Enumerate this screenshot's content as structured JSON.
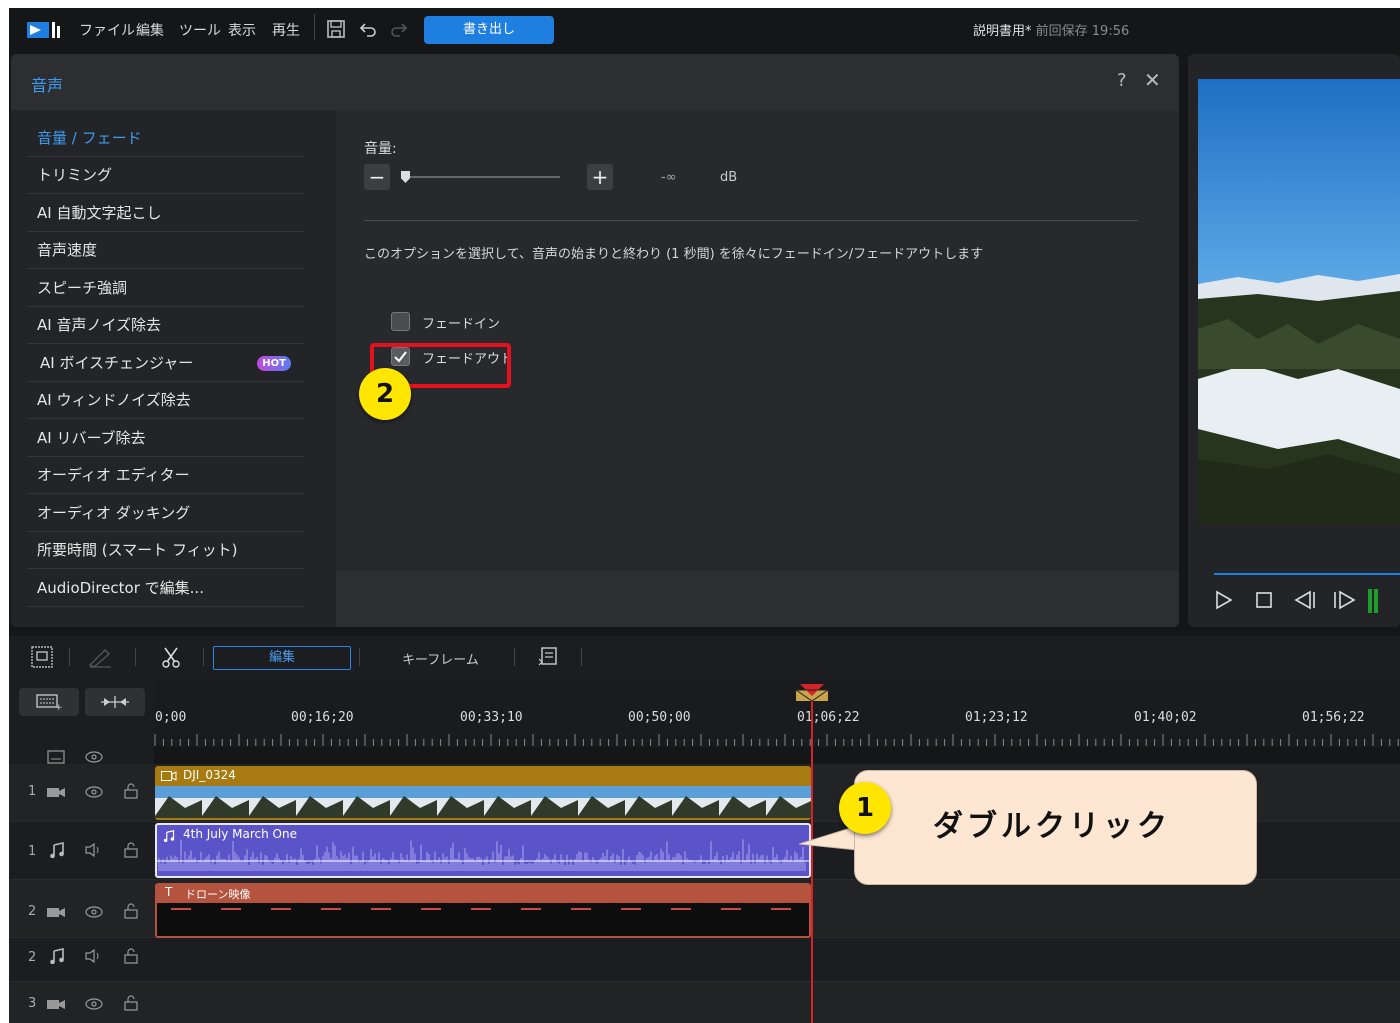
{
  "menubar": {
    "items": [
      "ファイル",
      "編集",
      "ツール",
      "表示",
      "再生"
    ],
    "export_label": "書き出し",
    "project_name": "説明書用*",
    "last_saved": "前回保存 19:56"
  },
  "dialog": {
    "title": "音声",
    "help": "?",
    "close": "✕",
    "sidebar": [
      {
        "label": "音量 / フェード",
        "active": true
      },
      {
        "label": "トリミング"
      },
      {
        "label": "AI 自動文字起こし"
      },
      {
        "label": "音声速度"
      },
      {
        "label": "スピーチ強調"
      },
      {
        "label": "AI 音声ノイズ除去"
      },
      {
        "label": "AI ボイスチェンジャー",
        "badge": "HOT"
      },
      {
        "label": "AI ウィンドノイズ除去"
      },
      {
        "label": "AI リバーブ除去"
      },
      {
        "label": "オーディオ エディター"
      },
      {
        "label": "オーディオ ダッキング"
      },
      {
        "label": "所要時間 (スマート フィット)"
      },
      {
        "label": "AudioDirector で編集..."
      }
    ],
    "volume": {
      "label": "音量:",
      "minus": "−",
      "plus": "+",
      "value": "-∞",
      "unit": "dB"
    },
    "description": "このオプションを選択して、音声の始まりと終わり (1 秒間) を徐々にフェードイン/フェードアウトします",
    "fade_in": {
      "label": "フェードイン",
      "checked": false
    },
    "fade_out": {
      "label": "フェードアウト",
      "checked": true
    }
  },
  "annotations": {
    "badge_1": "1",
    "badge_2": "2",
    "callout_text": "ダブルクリック",
    "highlight_color": "#e3121e",
    "badge_color": "#ffe600"
  },
  "timeline": {
    "edit_label": "編集",
    "keyframe_label": "キーフレーム",
    "ruler": [
      "0;00",
      "00;16;20",
      "00;33;10",
      "00;50;00",
      "01;06;22",
      "01;23;12",
      "01;40;02",
      "01;56;22"
    ],
    "tracks": [
      {
        "num": "1",
        "type": "video"
      },
      {
        "num": "1",
        "type": "audio"
      },
      {
        "num": "2",
        "type": "video"
      },
      {
        "num": "2",
        "type": "audio"
      },
      {
        "num": "3",
        "type": "video"
      }
    ],
    "clips": {
      "video": "DJI_0324",
      "audio": "4th July March One",
      "title": "ドローン映像"
    }
  },
  "preview": {
    "controls": [
      "play-icon",
      "stop-icon",
      "prev-frame-icon",
      "next-frame-icon"
    ]
  },
  "colors": {
    "accent": "#1f7fe0",
    "video_clip": "#a87a12",
    "audio_clip": "#5a54c8",
    "title_clip": "#b4533e",
    "playhead": "#d4242a"
  }
}
